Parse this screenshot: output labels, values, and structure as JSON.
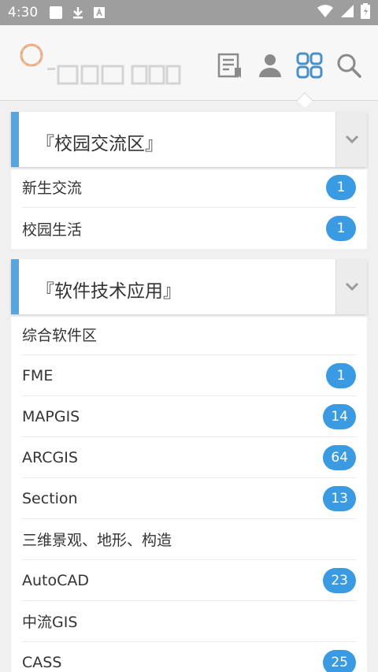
{
  "status_bar": {
    "time": "4:30",
    "icons_left": [
      "square-icon",
      "download-icon",
      "a-icon"
    ],
    "icons_right": [
      "wifi-icon",
      "signal-icon",
      "battery-icon"
    ]
  },
  "header": {
    "logo_icon": "ring-logo-icon",
    "nav_icons": [
      "posts-icon",
      "user-icon",
      "grid-icon",
      "search-icon"
    ]
  },
  "colors": {
    "accent": "#58a4dc",
    "badge": "#3a9be3",
    "nav_active": "#4a90c8"
  },
  "sections": [
    {
      "title": "『校园交流区』",
      "items": [
        {
          "label": "新生交流",
          "count": "1"
        },
        {
          "label": "校园生活",
          "count": "1"
        }
      ]
    },
    {
      "title": "『软件技术应用』",
      "items": [
        {
          "label": "综合软件区",
          "count": ""
        },
        {
          "label": "FME",
          "count": "1"
        },
        {
          "label": "MAPGIS",
          "count": "14"
        },
        {
          "label": "ARCGIS",
          "count": "64"
        },
        {
          "label": "Section",
          "count": "13"
        },
        {
          "label": "三维景观、地形、构造",
          "count": ""
        },
        {
          "label": "AutoCAD",
          "count": "23"
        },
        {
          "label": "中流GIS",
          "count": ""
        },
        {
          "label": "CASS",
          "count": "25"
        }
      ]
    }
  ]
}
